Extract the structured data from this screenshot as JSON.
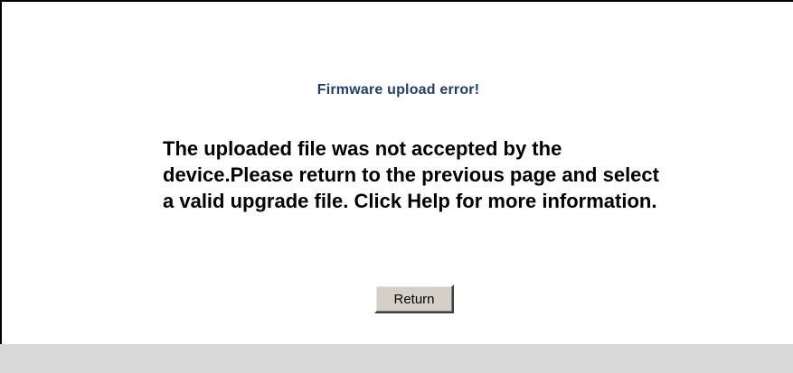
{
  "page": {
    "title": "Firmware upload error!",
    "message": "The uploaded file was not accepted by the device.Please return to the previous page and select a valid upgrade file. Click Help for more information.",
    "return_label": "Return"
  },
  "colors": {
    "title_text": "#1f3f6e",
    "button_face": "#d4d0c8",
    "bottom_bar": "#d9d9d9"
  }
}
